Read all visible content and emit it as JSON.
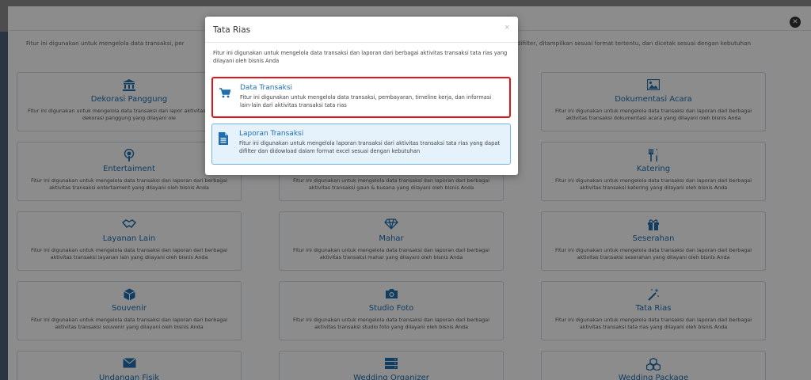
{
  "background": {
    "description_left": "Fitur ini digunakan untuk mengelola data transaksi, per",
    "description_right": "difilter, ditampilkan sesuai format tertentu, dan dicetak sesuai dengan kebutuhan",
    "close_icon": "close-circle-icon",
    "cards": [
      {
        "title": "Dekorasi Panggung",
        "icon": "bank-icon",
        "desc": "Fitur ini digunakan untuk mengelola data transaksi dan lapor aktivitas transaksi dekorasi panggung yang dilayani ole"
      },
      {
        "title": "",
        "icon": "",
        "desc": ""
      },
      {
        "title": "Dokumentasi Acara",
        "icon": "image-icon",
        "desc": "Fitur ini digunakan untuk mengelola data transaksi dan laporan dari berbagai aktivitas transaksi dokumentasi acara yang dilayani oleh bisnis Anda"
      },
      {
        "title": "Entertaiment",
        "icon": "podcast-icon",
        "desc": "Fitur ini digunakan untuk mengelola data transaksi dan laporan dari berbagai aktivitas transaksi entertaiment yang dilayani oleh bisnis Anda"
      },
      {
        "title": "",
        "icon": "",
        "desc": "Fitur ini digunakan untuk mengelola data transaksi dan laporan dari berbagai aktivitas transaksi gaun & busana yang dilayani oleh bisnis Anda"
      },
      {
        "title": "Katering",
        "icon": "utensils-icon",
        "desc": "Fitur ini digunakan untuk mengelola data transaksi dan laporan dari berbagai aktivitas transaksi katering yang dilayani oleh bisnis Anda"
      },
      {
        "title": "Layanan Lain",
        "icon": "handshake-icon",
        "desc": "Fitur ini digunakan untuk mengelola data transaksi dan laporan dari berbagai aktivitas transaksi layanan lain yang dilayani oleh bisnis Anda"
      },
      {
        "title": "Mahar",
        "icon": "diamond-icon",
        "desc": "Fitur ini digunakan untuk mengelola data transaksi dan laporan dari berbagai aktivitas transaksi mahar yang dilayani oleh bisnis Anda"
      },
      {
        "title": "Seserahan",
        "icon": "gift-icon",
        "desc": "Fitur ini digunakan untuk mengelola data transaksi dan laporan dari berbagai aktivitas transaksi seserahan yang dilayani oleh bisnis Anda"
      },
      {
        "title": "Souvenir",
        "icon": "cube-icon",
        "desc": "Fitur ini digunakan untuk mengelola data transaksi dan laporan dari berbagai aktivitas transaksi souvenir yang dilayani oleh bisnis Anda"
      },
      {
        "title": "Studio Foto",
        "icon": "camera-icon",
        "desc": "Fitur ini digunakan untuk mengelola data transaksi dan laporan dari berbagai aktivitas transaksi studio foto yang dilayani oleh bisnis Anda"
      },
      {
        "title": "Tata Rias",
        "icon": "magic-wand-icon",
        "desc": "Fitur ini digunakan untuk mengelola data transaksi dan laporan dari berbagai aktivitas transaksi tata rias yang dilayani oleh bisnis Anda"
      },
      {
        "title": "Undangan Fisik",
        "icon": "envelope-icon",
        "desc": ""
      },
      {
        "title": "Wedding Organizer",
        "icon": "server-icon",
        "desc": ""
      },
      {
        "title": "Wedding Package",
        "icon": "cubes-icon",
        "desc": ""
      }
    ]
  },
  "modal": {
    "title": "Tata Rias",
    "close_label": "×",
    "description": "Fitur ini digunakan untuk mengelola data transaksi dan laporan dari berbagai aktivitas transaksi tata rias yang dilayani oleh bisnis Anda",
    "options": [
      {
        "title": "Data Transaksi",
        "icon": "cart-icon",
        "desc": "Fitur ini digunakan untuk mengelola data transaksi, pembayaran, timeline kerja, dan informasi lain-lain dari aktivitas transaksi tata rias"
      },
      {
        "title": "Laporan Transaksi",
        "icon": "document-icon",
        "desc": "Fitur ini digunakan untuk mengelola laporan transaksi dari aktivitas transaksi tata rias yang dapat difilter dan didowload dalam format excel sesuai dengan kebutuhan"
      }
    ]
  },
  "colors": {
    "accent": "#1f6fb0",
    "highlight_border": "#e1141c",
    "selected_bg": "#e5f2fb"
  }
}
